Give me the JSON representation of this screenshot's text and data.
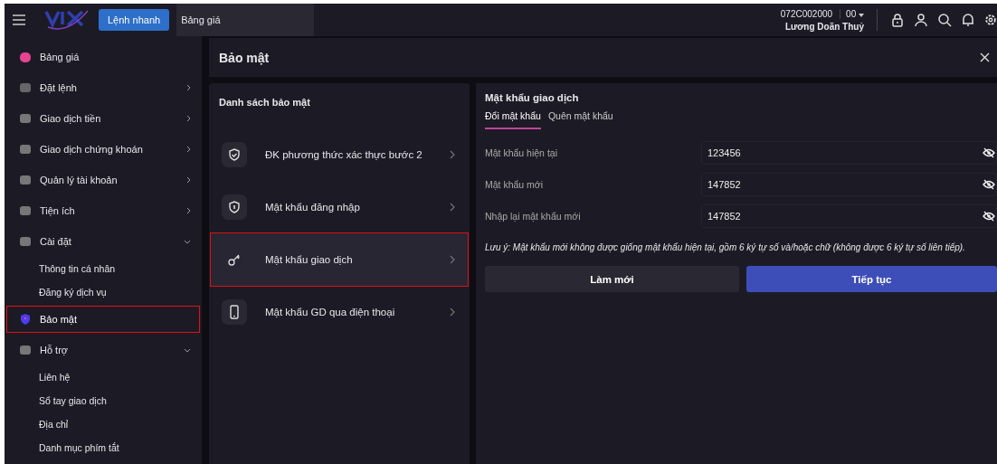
{
  "topbar": {
    "quick_order_button": "Lệnh nhanh",
    "tab": "Bảng giá",
    "account": "072C002000",
    "sub_account": "00",
    "user_name": "Lương Doãn Thuỷ"
  },
  "sidebar": {
    "items": [
      {
        "label": "Bảng giá",
        "has_submenu": false,
        "selected": false,
        "highlighted": false
      },
      {
        "label": "Đặt lệnh",
        "has_submenu": true,
        "expanded": false,
        "selected": false,
        "highlighted": false
      },
      {
        "label": "Giao dịch tiền",
        "has_submenu": true,
        "expanded": false,
        "selected": false,
        "highlighted": false
      },
      {
        "label": "Giao dịch chứng khoán",
        "has_submenu": true,
        "expanded": false,
        "selected": false,
        "highlighted": false
      },
      {
        "label": "Quản lý tài khoản",
        "has_submenu": true,
        "expanded": false,
        "selected": false,
        "highlighted": false
      },
      {
        "label": "Tiện ích",
        "has_submenu": true,
        "expanded": false,
        "selected": false,
        "highlighted": false
      },
      {
        "label": "Cài đặt",
        "has_submenu": true,
        "expanded": true,
        "selected": false,
        "highlighted": false,
        "children": [
          {
            "label": "Thông tin cá nhân"
          },
          {
            "label": "Đăng ký dịch vụ"
          }
        ]
      },
      {
        "label": "Bảo mật",
        "has_submenu": false,
        "selected": true,
        "highlighted": true
      },
      {
        "label": "Hỗ trợ",
        "has_submenu": true,
        "expanded": true,
        "selected": false,
        "highlighted": false,
        "children": [
          {
            "label": "Liên hệ"
          },
          {
            "label": "Sổ tay giao dịch"
          },
          {
            "label": "Địa chỉ"
          },
          {
            "label": "Danh mục phím tắt"
          }
        ]
      }
    ]
  },
  "header": {
    "title": "Bảo mật"
  },
  "security_list": {
    "title": "Danh sách bảo mật",
    "items": [
      {
        "label": "ĐK phương thức xác thực bước 2",
        "selected": false,
        "highlighted": false
      },
      {
        "label": "Mật khẩu đăng nhập",
        "selected": false,
        "highlighted": false
      },
      {
        "label": "Mật khẩu giao dịch",
        "selected": true,
        "highlighted": true
      },
      {
        "label": "Mật khẩu GD qua điện thoại",
        "selected": false,
        "highlighted": false
      }
    ]
  },
  "form": {
    "title": "Mật khẩu giao dịch",
    "tabs": [
      {
        "label": "Đổi mật khẩu",
        "selected": true
      },
      {
        "label": "Quên mật khẩu",
        "selected": false
      }
    ],
    "fields": [
      {
        "label": "Mật khẩu hiện tại",
        "value": "123456"
      },
      {
        "label": "Mật khẩu mới",
        "value": "147852"
      },
      {
        "label": "Nhập lại mật khẩu mới",
        "value": "147852"
      }
    ],
    "note": "Lưu ý: Mật khẩu mới không được giống mật khẩu hiện tại, gồm 6 ký tự số và/hoặc chữ (không được 6 ký tự số liên tiếp).",
    "buttons": [
      {
        "label": "Làm mới",
        "kind": "secondary"
      },
      {
        "label": "Tiếp tục",
        "kind": "primary"
      }
    ]
  }
}
